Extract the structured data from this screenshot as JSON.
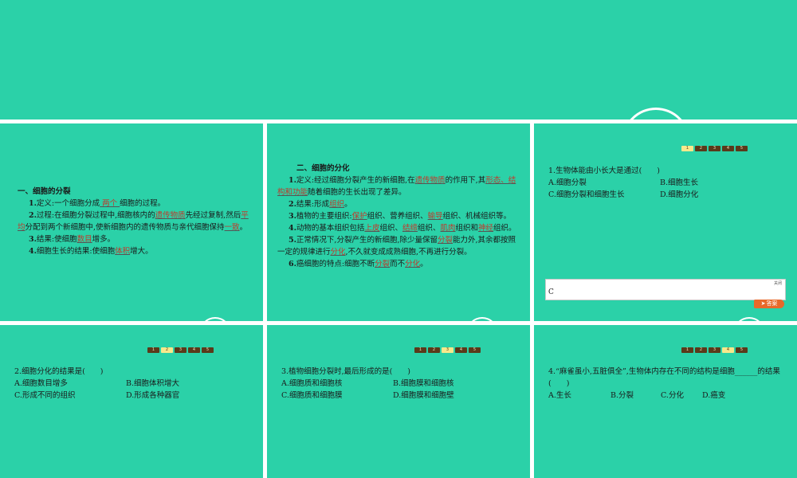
{
  "slide1": {
    "heading": "一、细胞的分裂",
    "items": [
      {
        "num": "1.",
        "parts": [
          {
            "t": "定义:一个细胞分成"
          },
          {
            "t": "   两个  ",
            "blank": true
          },
          {
            "t": "细胞的过程。"
          }
        ]
      },
      {
        "num": "2.",
        "parts": [
          {
            "t": "过程:在细胞分裂过程中,细胞核内的"
          },
          {
            "t": "遗传物质",
            "blank": true
          },
          {
            "t": "先经过复制,然后"
          },
          {
            "t": "平均",
            "blank": true
          },
          {
            "t": "分配到两个新细胞中,使新细胞内的遗传物质与亲代细胞保持"
          },
          {
            "t": "一致",
            "blank": true
          },
          {
            "t": "。"
          }
        ]
      },
      {
        "num": "3.",
        "parts": [
          {
            "t": "结果:使细胞"
          },
          {
            "t": "数目",
            "blank": true
          },
          {
            "t": "增多。"
          }
        ]
      },
      {
        "num": "4.",
        "parts": [
          {
            "t": "细胞生长的结果:使细胞"
          },
          {
            "t": "体积",
            "blank": true
          },
          {
            "t": "增大。"
          }
        ]
      }
    ]
  },
  "slide2": {
    "heading": "二、细胞的分化",
    "items": [
      {
        "num": "1.",
        "parts": [
          {
            "t": "定义:经过细胞分裂产生的新细胞,在"
          },
          {
            "t": "遗传物质",
            "blank": true
          },
          {
            "t": "的作用下,其"
          },
          {
            "t": "形态、结构和功能",
            "blank": true
          },
          {
            "t": "随着细胞的生长出现了差异。"
          }
        ]
      },
      {
        "num": "2.",
        "parts": [
          {
            "t": "结果:形成"
          },
          {
            "t": "组织",
            "blank": true
          },
          {
            "t": "。"
          }
        ]
      },
      {
        "num": "3.",
        "parts": [
          {
            "t": "植物的主要组织:"
          },
          {
            "t": "保护",
            "blank": true
          },
          {
            "t": "组织、营养组织、"
          },
          {
            "t": "输导",
            "blank": true
          },
          {
            "t": "组织、机械组织等。"
          }
        ]
      },
      {
        "num": "4.",
        "parts": [
          {
            "t": "动物的基本组织包括"
          },
          {
            "t": "上皮",
            "blank": true
          },
          {
            "t": "组织、"
          },
          {
            "t": "结缔",
            "blank": true
          },
          {
            "t": "组织、"
          },
          {
            "t": "肌肉",
            "blank": true
          },
          {
            "t": "组织和"
          },
          {
            "t": "神经",
            "blank": true
          },
          {
            "t": "组织。"
          }
        ]
      },
      {
        "num": "5.",
        "parts": [
          {
            "t": "正常情况下,分裂产生的新细胞,除少量保留"
          },
          {
            "t": "分裂",
            "blank": true
          },
          {
            "t": "能力外,其余都按照一定的规律进行"
          },
          {
            "t": "分化",
            "blank": true
          },
          {
            "t": ",不久就变成成熟细胞,不再进行分裂。"
          }
        ]
      },
      {
        "num": "6.",
        "parts": [
          {
            "t": "癌细胞的特点:细胞不断"
          },
          {
            "t": "分裂",
            "blank": true
          },
          {
            "t": "而不"
          },
          {
            "t": "分化",
            "blank": true
          },
          {
            "t": "。"
          }
        ]
      }
    ]
  },
  "pager": [
    "1",
    "2",
    "3",
    "4",
    "5"
  ],
  "q1": {
    "stem": "1.生物体能由小长大是通过(　　)",
    "options": [
      "A.细胞分裂",
      "B.细胞生长",
      "C.细胞分裂和细胞生长",
      "D.细胞分化"
    ],
    "answer_close": "关闭",
    "answer": "C",
    "answer_button": "答案"
  },
  "q2": {
    "stem": "2.细胞分化的结果是(　　)",
    "options": [
      "A.细胞数目增多",
      "B.细胞体积增大",
      "C.形成不同的组织",
      "D.形成各种器官"
    ]
  },
  "q3": {
    "stem": "3.植物细胞分裂时,最后形成的是(　　)",
    "options": [
      "A.细胞质和细胞核",
      "B.细胞膜和细胞核",
      "C.细胞质和细胞膜",
      "D.细胞膜和细胞壁"
    ]
  },
  "q4": {
    "stem": "4.“麻雀虽小,五脏俱全”,生物体内存在不同的结构是细胞______的结果(　　)",
    "options": [
      "A.生长",
      "B.分裂",
      "C.分化",
      "D.癌变"
    ]
  },
  "colors": {
    "slide_bg": "#2bd1a8",
    "blank_text": "#c0392b",
    "pager_bg": "#5a3a1a",
    "pager_active": "#f7e98c",
    "answer_button": "#e8692a"
  }
}
